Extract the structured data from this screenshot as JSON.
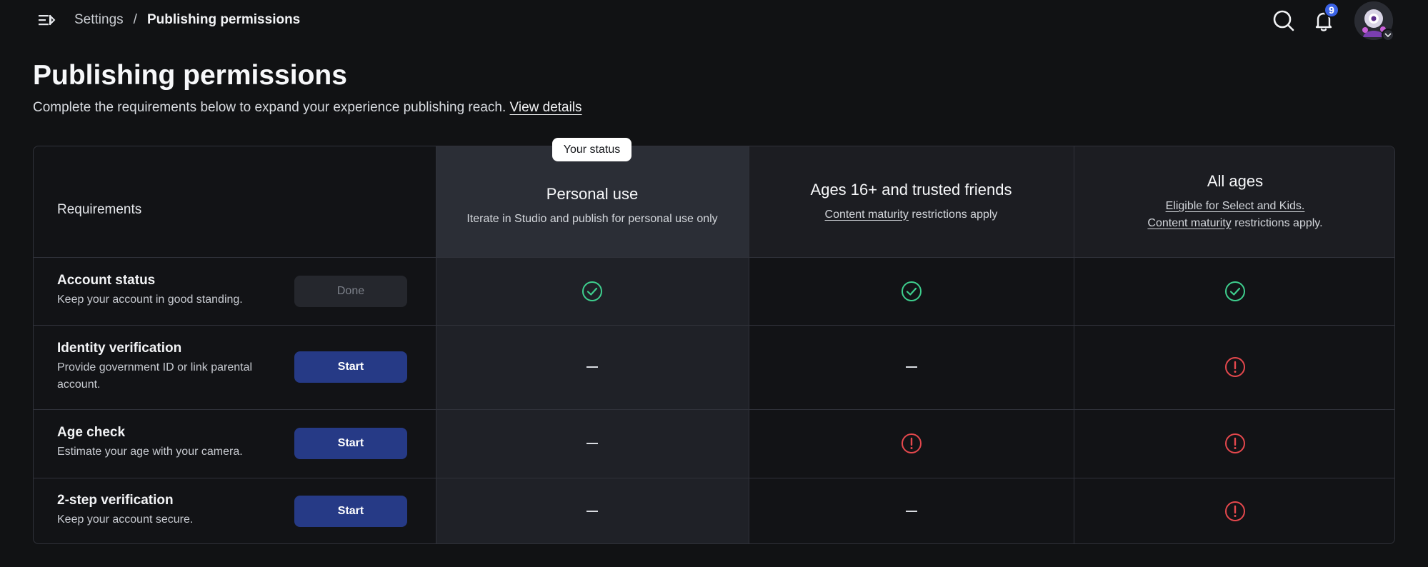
{
  "topbar": {
    "menu_icon": "menu-collapse-icon",
    "breadcrumb": {
      "parent": "Settings",
      "separator": "/",
      "current": "Publishing permissions"
    },
    "search_icon": "search-icon",
    "bell_icon": "bell-icon",
    "notification_count": "9",
    "avatar_icon": "avatar-icon",
    "avatar_caret_icon": "chevron-down-icon"
  },
  "heading": {
    "title": "Publishing permissions",
    "subtitle": "Complete the requirements below to expand your experience publishing reach.",
    "details_link": "View details"
  },
  "table": {
    "requirements_header": "Requirements",
    "status_pill": "Your status",
    "columns": [
      {
        "title": "Personal use",
        "desc": "Iterate in Studio and publish for personal use only"
      },
      {
        "title": "Ages 16+ and trusted friends",
        "desc_link": "Content maturity",
        "desc_rest": " restrictions apply"
      },
      {
        "title": "All ages",
        "desc_line1": "Eligible for Select and Kids.",
        "desc_link": "Content maturity",
        "desc_rest": " restrictions apply."
      }
    ],
    "rows": [
      {
        "name": "Account status",
        "desc": "Keep your account in good standing.",
        "button": "Done",
        "cells": [
          "check",
          "check",
          "check"
        ]
      },
      {
        "name": "Identity verification",
        "desc": "Provide government ID or link parental account.",
        "button": "Start",
        "cells": [
          "dash",
          "dash",
          "alert"
        ]
      },
      {
        "name": "Age check",
        "desc": "Estimate your age with your camera.",
        "button": "Start",
        "cells": [
          "dash",
          "alert",
          "alert"
        ]
      },
      {
        "name": "2-step verification",
        "desc": "Keep your account secure.",
        "button": "Start",
        "cells": [
          "dash",
          "dash",
          "alert"
        ]
      }
    ],
    "colors": {
      "check": "#3ecf8e",
      "alert": "#e5484d",
      "accent_button": "#263a86"
    }
  }
}
